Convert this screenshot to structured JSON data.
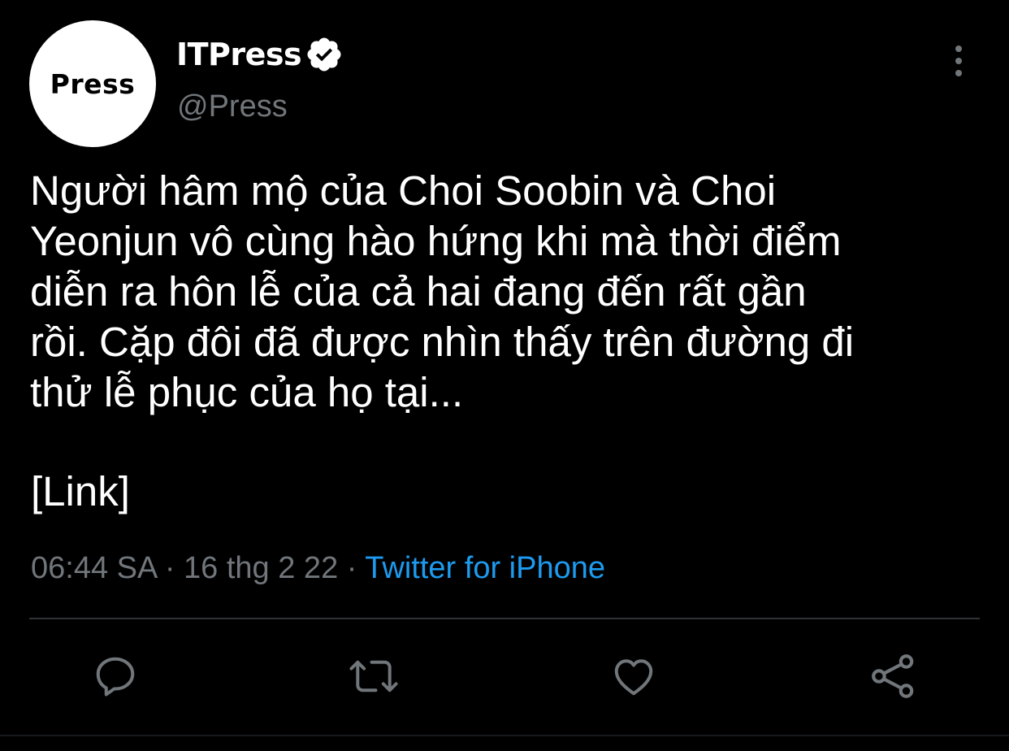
{
  "tweet": {
    "avatar_text": "Press",
    "display_name": "ITPress",
    "handle": "@Press",
    "text_lines": [
      "Người hâm mộ của Choi Soobin và Choi",
      "Yeonjun vô cùng hào hứng khi mà thời điểm",
      "diễn ra hôn lễ của cả hai đang đến rất gần",
      "rồi. Cặp đôi đã được nhìn thấy trên đường đi",
      "thử lễ phục của họ tại..."
    ],
    "link_text": "[Link]",
    "time": "06:44 SA",
    "date": "16 thg 2 22",
    "separator": "·",
    "source": "Twitter for iPhone"
  },
  "icons": {
    "verified": "verified-badge-icon",
    "more": "more-vertical-icon",
    "reply": "reply-icon",
    "retweet": "retweet-icon",
    "like": "heart-icon",
    "share": "share-icon"
  },
  "colors": {
    "background": "#000000",
    "text": "#ffffff",
    "secondary_text": "#71767b",
    "link": "#1d9bf0"
  }
}
